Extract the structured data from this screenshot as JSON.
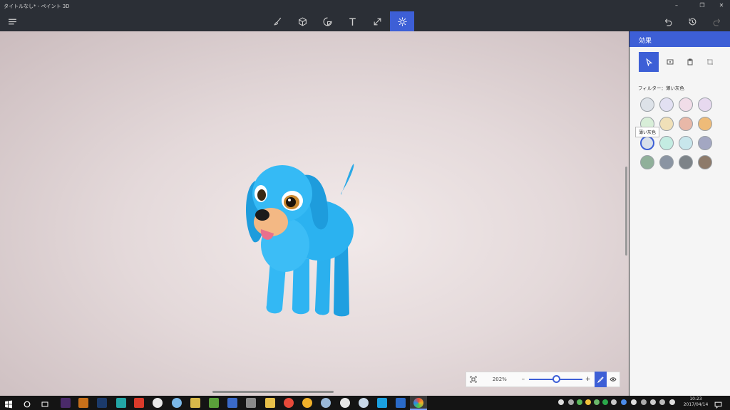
{
  "window": {
    "title": "タイトルなし* - ペイント 3D"
  },
  "toolbar": {
    "tools": [
      {
        "name": "brushes",
        "icon": "brush-icon"
      },
      {
        "name": "3d-objects",
        "icon": "cube-icon"
      },
      {
        "name": "stickers",
        "icon": "sticker-icon"
      },
      {
        "name": "text",
        "icon": "text-icon"
      },
      {
        "name": "canvas",
        "icon": "canvas-icon"
      },
      {
        "name": "effects",
        "icon": "sun-icon",
        "active": true
      }
    ]
  },
  "panel": {
    "title": "効果",
    "filter_label": "フィルター：薄い灰色",
    "tooltip": "薄い灰色",
    "swatches": [
      "#dde2e8",
      "#e2e0f2",
      "#f1dde8",
      "#e7d9ef",
      "#d8eed8",
      "#f0e0b8",
      "#e8b8a8",
      "#eebb78",
      "#d8e0ea",
      "#c4ece2",
      "#c8e6ec",
      "#a3a7c2",
      "#90b09a",
      "#8a94a2",
      "#7d8388",
      "#8d7a6a"
    ],
    "selected_index": 8
  },
  "zoom": {
    "label": "202%",
    "level": 0.5
  },
  "taskbar": {
    "clock_time": "10:23",
    "clock_date": "2017/04/14"
  },
  "colors": {
    "accent": "#3d5fd6"
  }
}
